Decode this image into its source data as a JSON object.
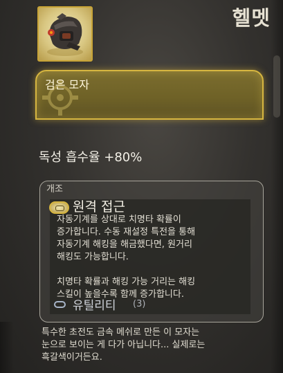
{
  "item": {
    "category": "헬멧",
    "name": "검은 모자",
    "stat": "독성 흡수율 +80%",
    "icon": "helmet-icon"
  },
  "mods": {
    "header": "개조",
    "primary": {
      "name": "원격 접근",
      "icon": "chip-mod-icon",
      "description": "자동기계를 상대로 치명타 확률이\n증가합니다. 수동 재설정 특전을 통해\n자동기계 해킹을 해금했다면, 원거리\n해킹도 가능합니다.\n\n치명타 확률과 해킹 가능 거리는 해킹\n스킬이 높을수록 함께 증가합니다."
    },
    "secondary": {
      "name": "유틸리티",
      "count": "(3)",
      "icon": "empty-slot-icon"
    }
  },
  "flavor_text": "특수한 초전도 금속 메쉬로 만든 이 모자는\n눈으로 보이는 게 다가 아닙니다... 실제로는\n흑갈색이거든요.",
  "colors": {
    "accent_gold": "#d7b640",
    "banner": "#6f6227",
    "background": "#33312e"
  }
}
